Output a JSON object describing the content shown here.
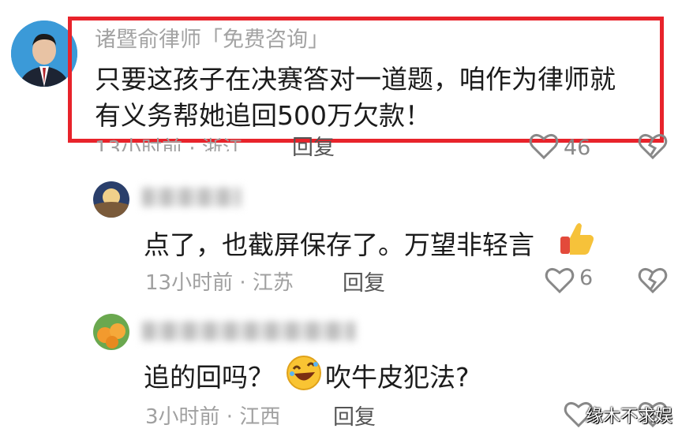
{
  "comments": [
    {
      "author": "诸暨俞律师「免费咨询」",
      "text_line1": "只要这孩子在决赛答对一道题，咱作为律师就",
      "text_line2": "有义务帮她追回500万欠款！",
      "time_location": "13小时前 · 浙江",
      "reply_label": "回复",
      "likes": "46",
      "highlighted": true
    },
    {
      "author": "",
      "text": "点了，也截屏保存了。万望非轻言",
      "emoji": "thumbs-up",
      "time_location": "13小时前 · 江苏",
      "reply_label": "回复",
      "likes": "6"
    },
    {
      "author": "",
      "text_before_emoji": "追的回吗？",
      "emoji": "rolling-laughing",
      "text_after_emoji": "吹牛皮犯法?",
      "time_location": "3小时前 · 江西",
      "reply_label": "回复",
      "likes": ""
    }
  ],
  "watermark": "缘木不求娱",
  "colors": {
    "highlight_border": "#e8232b",
    "meta_text": "#a0a0a0"
  }
}
